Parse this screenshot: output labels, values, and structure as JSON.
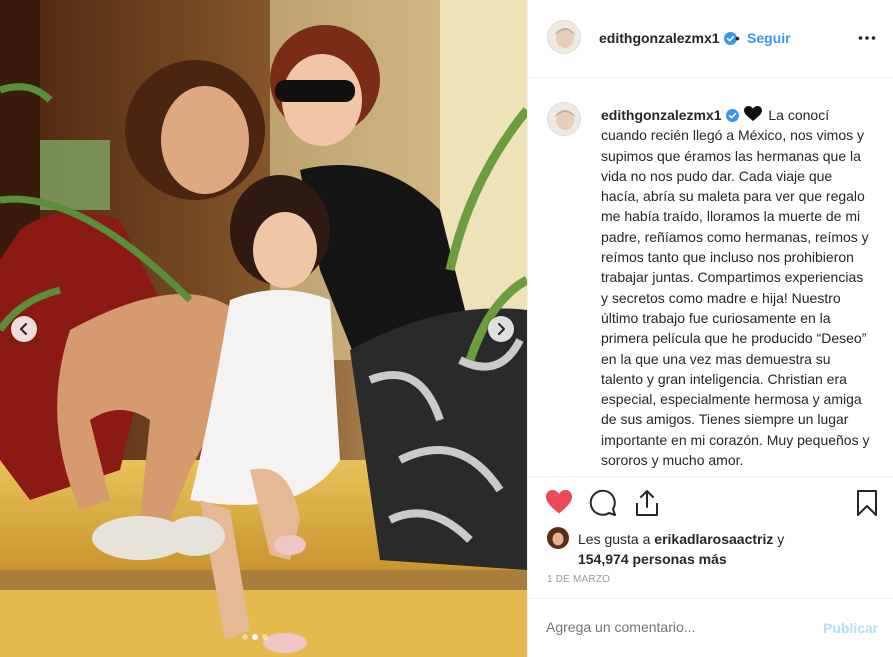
{
  "post": {
    "username": "edithgonzalezmx1",
    "verified_icon": "verified-badge-icon",
    "follow_label": "Seguir",
    "follow_separator": "•",
    "more_icon": "more-options-icon",
    "caption_emoji": "black-heart-emoji",
    "caption_text": "La conocí cuando recién llegó a México, nos vimos y supimos que éramos las hermanas que la vida no nos pudo dar. Cada viaje que hacía, abría su maleta para ver que regalo me había traído, lloramos la muerte de mi padre, reñíamos como hermanas, reímos y reímos tanto que incluso nos prohibieron trabajar juntas. Compartimos experiencias y secretos como madre e hija! Nuestro último trabajo fue curiosamente en la primera película que he producido “Deseo” en la que una vez mas demuestra su talento y gran inteligencia. Christian era especial, especialmente hermosa y amiga de sus amigos. Tienes siempre un lugar importante en mi corazón. Muy pequeños y sororos y mucho amor.",
    "likes": {
      "prefix": "Les gusta a ",
      "user": "erikadlarosaactriz",
      "joiner": " y",
      "count": "154,974 personas más"
    },
    "date": "1 DE MARZO",
    "comment_placeholder": "Agrega un comentario...",
    "publish_label": "Publicar"
  },
  "carousel": {
    "slide_count": 3,
    "active_index": 1
  },
  "colors": {
    "accent_blue": "#3897f0",
    "like_red": "#ed4956",
    "publish_disabled": "#b2dffc",
    "muted_text": "#999999",
    "divider": "#efefef"
  }
}
